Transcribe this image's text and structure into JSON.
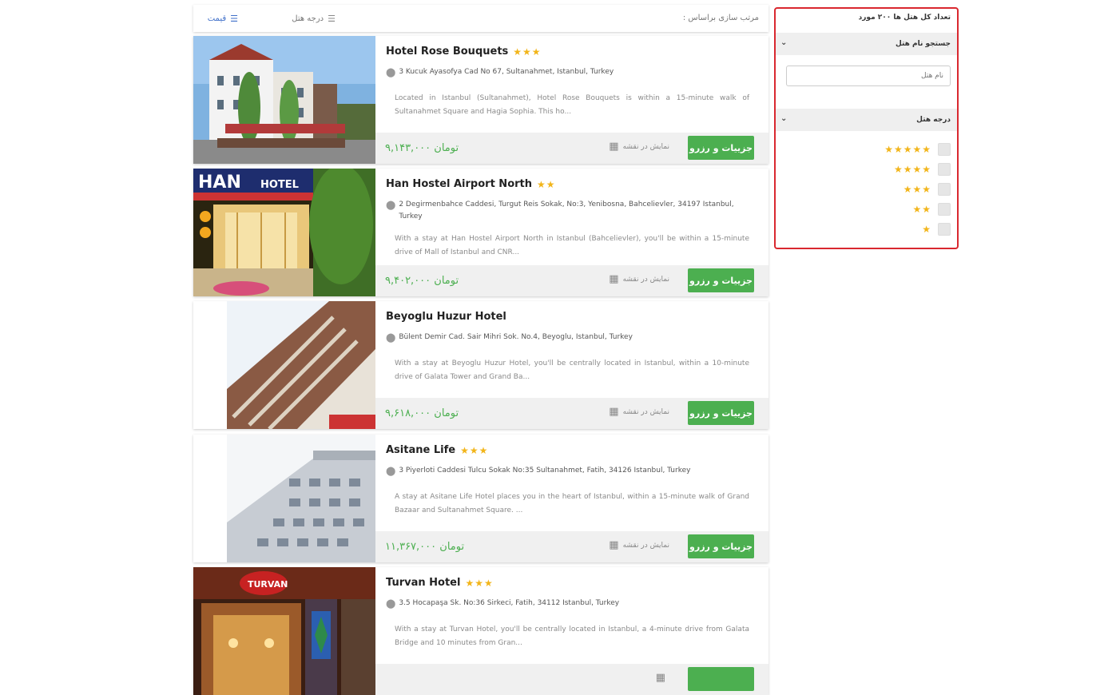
{
  "sortbar": {
    "label": "مرتب سازی براساس :",
    "by_stars": "درجه هتل",
    "by_price": "قیمت"
  },
  "hotels": [
    {
      "name": "Hotel Rose Bouquets",
      "stars": "★★★",
      "address": "3 Kucuk Ayasofya Cad No 67, Sultanahmet, Istanbul, Turkey",
      "description": "Located in Istanbul (Sultanahmet), Hotel Rose Bouquets is within a 15-minute walk of Sultanahmet Square and Hagia Sophia. This ho...",
      "price": "۹,۱۴۳,۰۰۰ تومان",
      "map_label": "نمایش در نقشه",
      "book_label": "جزییات و رزرو"
    },
    {
      "name": "Han Hostel Airport North",
      "stars": "★★",
      "address": "2 Degirmenbahce Caddesi, Turgut Reis Sokak, No:3, Yenibosna, Bahcelievler, 34197 Istanbul, Turkey",
      "description": "With a stay at Han Hostel Airport North in Istanbul (Bahcelievler), you'll be within a 15-minute drive of Mall of Istanbul and CNR...",
      "price": "۹,۴۰۲,۰۰۰ تومان",
      "map_label": "نمایش در نقشه",
      "book_label": "جزییات و رزرو"
    },
    {
      "name": "Beyoglu Huzur Hotel",
      "stars": "",
      "address": "Bülent Demir Cad. Sair Mihri Sok. No.4, Beyoglu, Istanbul, Turkey",
      "description": "With a stay at Beyoglu Huzur Hotel, you'll be centrally located in Istanbul, within a 10-minute drive of Galata Tower and Grand Ba...",
      "price": "۹,۶۱۸,۰۰۰ تومان",
      "map_label": "نمایش در نقشه",
      "book_label": "جزییات و رزرو"
    },
    {
      "name": "Asitane Life",
      "stars": "★★★",
      "address": "3 Piyerloti Caddesi Tulcu Sokak No:35 Sultanahmet, Fatih, 34126 Istanbul, Turkey",
      "description": "A stay at Asitane Life Hotel places you in the heart of Istanbul, within a 15-minute walk of Grand Bazaar and Sultanahmet Square. ...",
      "price": "۱۱,۳۶۷,۰۰۰ تومان",
      "map_label": "نمایش در نقشه",
      "book_label": "جزییات و رزرو"
    },
    {
      "name": "Turvan Hotel",
      "stars": "★★★",
      "address": "3.5 Hocapaşa Sk. No:36 Sirkeci, Fatih, 34112 Istanbul, Turkey",
      "description": "With a stay at Turvan Hotel, you'll be centrally located in Istanbul, a 4-minute drive from Galata Bridge and 10 minutes from Gran...",
      "price": "",
      "map_label": "",
      "book_label": ""
    }
  ],
  "filter": {
    "total": "تعداد کل هتل ها ۲۰۰ مورد",
    "name_section": "جستجو نام هتل",
    "name_placeholder": "نام هتل",
    "stars_section": "درجه هتل",
    "star_options": [
      "★★★★★",
      "★★★★",
      "★★★",
      "★★",
      "★"
    ]
  },
  "colors": {
    "accent_green": "#4caf50",
    "star_gold": "#f2b51a",
    "filter_border": "#d9282f",
    "sort_active": "#3f6fc9"
  }
}
